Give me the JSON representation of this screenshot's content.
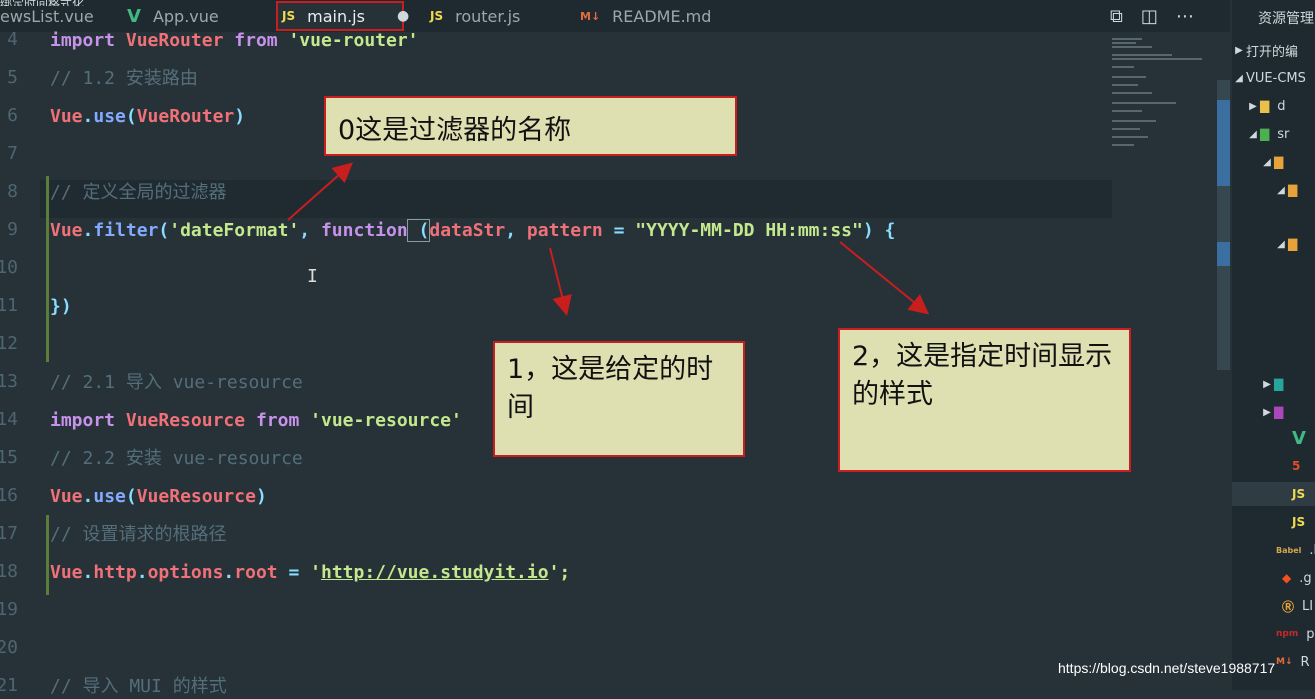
{
  "top_partial_text": "绑定时间格式化",
  "tabs": [
    {
      "label": "ewsList.vue",
      "icon": "",
      "icon_color": "#42b883"
    },
    {
      "label": "App.vue",
      "icon": "V",
      "icon_color": "#42b883"
    },
    {
      "label": "main.js",
      "icon": "JS",
      "icon_color": "#f0db4f",
      "active": true
    },
    {
      "label": "router.js",
      "icon": "JS",
      "icon_color": "#f0db4f"
    },
    {
      "label": "README.md",
      "icon": "M↓",
      "icon_color": "#e46c3c"
    }
  ],
  "sidebar": {
    "title": "资源管理",
    "items": [
      "打开的编",
      "VUE-CMS",
      "d",
      "sr",
      "",
      "",
      "",
      "",
      "",
      "",
      "",
      "",
      "JS",
      "JS",
      ".b",
      ".g",
      "LI",
      "pa",
      "R"
    ]
  },
  "line_numbers": [
    "4",
    "5",
    "6",
    "7",
    "8",
    "9",
    "10",
    "11",
    "12",
    "13",
    "14",
    "15",
    "16",
    "17",
    "18",
    "19",
    "20",
    "21"
  ],
  "code": {
    "l4": [
      "import",
      "VueRouter",
      "from",
      "'vue-router'"
    ],
    "l5": "// 1.2 安装路由",
    "l6": [
      "Vue",
      ".",
      "use",
      "(",
      "VueRouter",
      ")"
    ],
    "l8": "// 定义全局的过滤器",
    "l9": [
      "Vue",
      ".",
      "filter",
      "(",
      "'dateFormat'",
      ", ",
      "function",
      " (",
      "dataStr",
      ", ",
      "pattern",
      " = ",
      "\"YYYY-MM-DD HH:mm:ss\"",
      ") {"
    ],
    "l11": "})",
    "l13": "// 2.1 导入 vue-resource",
    "l14": [
      "import",
      "VueResource",
      "from",
      "'vue-resource'"
    ],
    "l15": "// 2.2 安装 vue-resource",
    "l16": [
      "Vue",
      ".",
      "use",
      "(",
      "VueResource",
      ")"
    ],
    "l17": "// 设置请求的根路径",
    "l18": [
      "Vue",
      ".",
      "http",
      ".",
      "options",
      ".",
      "root",
      " = ",
      "'",
      "http://vue.studyit.io",
      "';"
    ],
    "l21": "// 导入 MUI 的样式"
  },
  "notes": {
    "n0": "0这是过滤器的名称",
    "n1": "1，这是给定的时间",
    "n2": "2，这是指定时间显示的样式"
  },
  "watermark": "https://blog.csdn.net/steve1988717"
}
